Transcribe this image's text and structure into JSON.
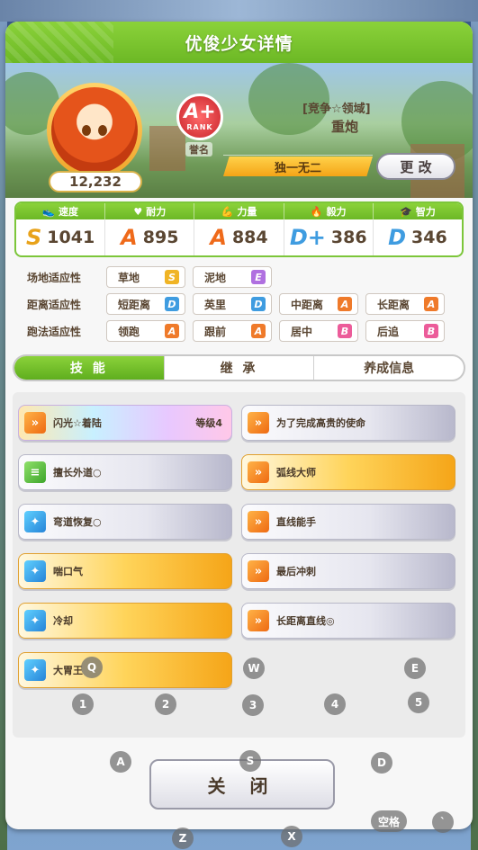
{
  "title": "优俊少女详情",
  "character": {
    "score": "12,232"
  },
  "rank": {
    "grade": "A+",
    "label": "RANK",
    "subtitle": "誉名"
  },
  "epithet": {
    "top": "[竞争☆领域]",
    "main": "重炮"
  },
  "unique_label": "独一无二",
  "change_button": "更 改",
  "stats": [
    {
      "name": "速度",
      "grade": "S",
      "value": "1041"
    },
    {
      "name": "耐力",
      "grade": "A",
      "value": "895"
    },
    {
      "name": "力量",
      "grade": "A",
      "value": "884"
    },
    {
      "name": "毅力",
      "grade": "D+",
      "value": "386"
    },
    {
      "name": "智力",
      "grade": "D",
      "value": "346"
    }
  ],
  "aptitudes": {
    "track": {
      "label": "场地适应性",
      "items": [
        {
          "name": "草地",
          "grade": "S"
        },
        {
          "name": "泥地",
          "grade": "E"
        }
      ]
    },
    "distance": {
      "label": "距离适应性",
      "items": [
        {
          "name": "短距离",
          "grade": "D"
        },
        {
          "name": "英里",
          "grade": "D"
        },
        {
          "name": "中距离",
          "grade": "A"
        },
        {
          "name": "长距离",
          "grade": "A"
        }
      ]
    },
    "style": {
      "label": "跑法适应性",
      "items": [
        {
          "name": "领跑",
          "grade": "A"
        },
        {
          "name": "跟前",
          "grade": "A"
        },
        {
          "name": "居中",
          "grade": "B"
        },
        {
          "name": "后追",
          "grade": "B"
        }
      ]
    }
  },
  "tabs": [
    "技 能",
    "继 承",
    "养成信息"
  ],
  "skills": [
    {
      "name": "闪光☆着陆",
      "level": "等级4",
      "style": "rainbow",
      "icon": "orange"
    },
    {
      "name": "为了完成高贵的使命",
      "level": "",
      "style": "white",
      "icon": "orange"
    },
    {
      "name": "擅长外道○",
      "level": "",
      "style": "white",
      "icon": "green"
    },
    {
      "name": "弧线大师",
      "level": "",
      "style": "gold",
      "icon": "orange"
    },
    {
      "name": "弯道恢复○",
      "level": "",
      "style": "white",
      "icon": "blue"
    },
    {
      "name": "直线能手",
      "level": "",
      "style": "white",
      "icon": "orange"
    },
    {
      "name": "喘口气",
      "level": "",
      "style": "gold",
      "icon": "blue"
    },
    {
      "name": "最后冲刺",
      "level": "",
      "style": "white",
      "icon": "orange"
    },
    {
      "name": "冷却",
      "level": "",
      "style": "gold",
      "icon": "blue"
    },
    {
      "name": "长距离直线◎",
      "level": "",
      "style": "white",
      "icon": "orange"
    },
    {
      "name": "大胃王",
      "level": "",
      "style": "gold",
      "icon": "blue"
    }
  ],
  "close_button": "关 闭",
  "key_hints": {
    "q": "Q",
    "w": "W",
    "e": "E",
    "k1": "1",
    "k2": "2",
    "k3": "3",
    "k4": "4",
    "k5": "5",
    "a": "A",
    "s": "S",
    "d": "D",
    "z": "Z",
    "x": "X",
    "space": "空格",
    "backtick": "`"
  }
}
